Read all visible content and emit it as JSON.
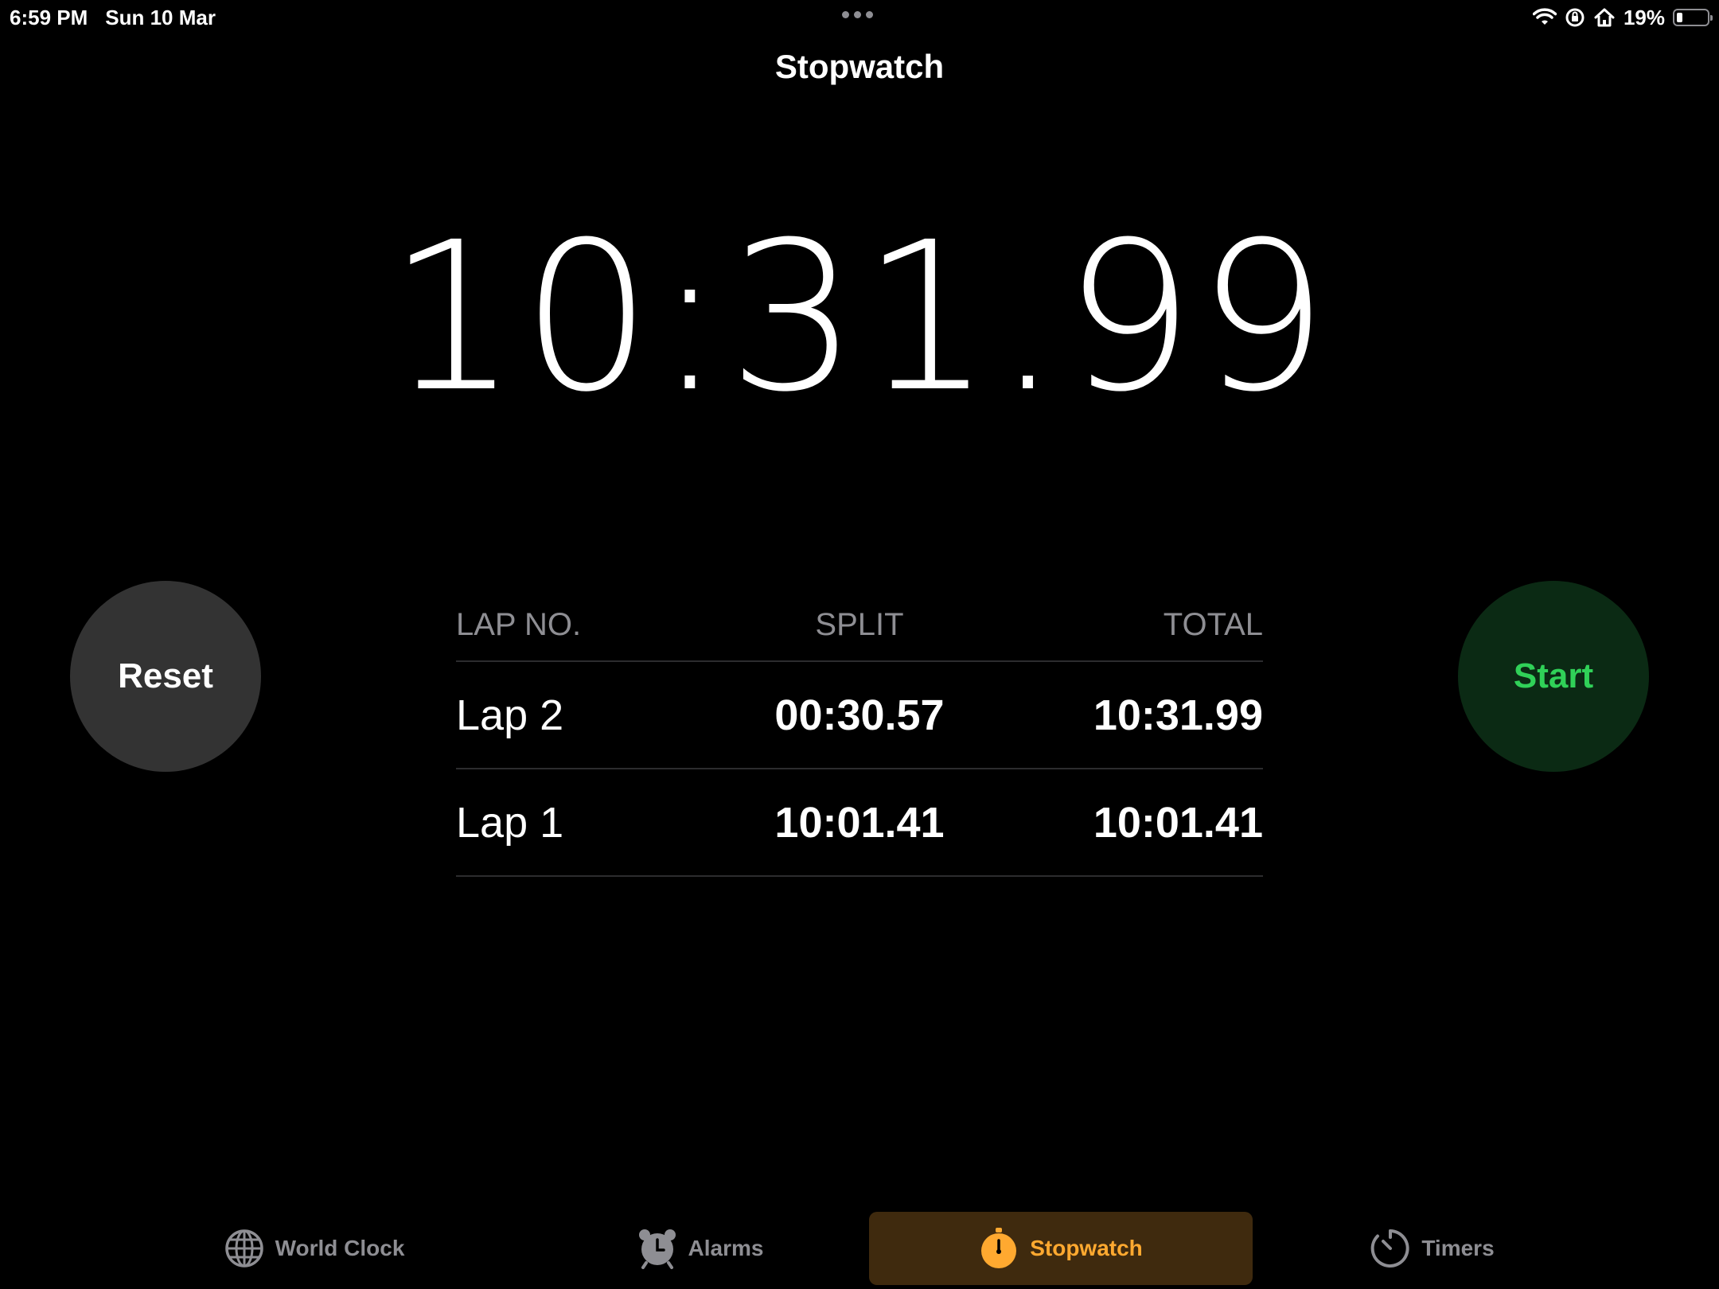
{
  "status_bar": {
    "time": "6:59 PM",
    "date": "Sun 10 Mar",
    "battery_percent": "19%",
    "battery_level": 0.19,
    "icons": [
      "wifi-icon",
      "screen-lock-rotation-icon",
      "home-icon",
      "battery-icon"
    ]
  },
  "header": {
    "title": "Stopwatch"
  },
  "stopwatch": {
    "time": "10:31.99"
  },
  "buttons": {
    "reset_label": "Reset",
    "start_label": "Start"
  },
  "laps": {
    "headers": {
      "lap_no": "LAP NO.",
      "split": "SPLIT",
      "total": "TOTAL"
    },
    "rows": [
      {
        "lap": "Lap 2",
        "split": "00:30.57",
        "total": "10:31.99"
      },
      {
        "lap": "Lap 1",
        "split": "10:01.41",
        "total": "10:01.41"
      }
    ]
  },
  "tabbar": {
    "tabs": [
      {
        "label": "World Clock",
        "icon": "globe-icon",
        "selected": false
      },
      {
        "label": "Alarms",
        "icon": "alarm-clock-icon",
        "selected": false
      },
      {
        "label": "Stopwatch",
        "icon": "stopwatch-icon",
        "selected": true
      },
      {
        "label": "Timers",
        "icon": "timer-icon",
        "selected": false
      }
    ]
  },
  "colors": {
    "background": "#000000",
    "accent": "#ffa930",
    "start_green": "#30d158",
    "reset_gray": "#333333",
    "secondary_text": "#8e8e93"
  }
}
